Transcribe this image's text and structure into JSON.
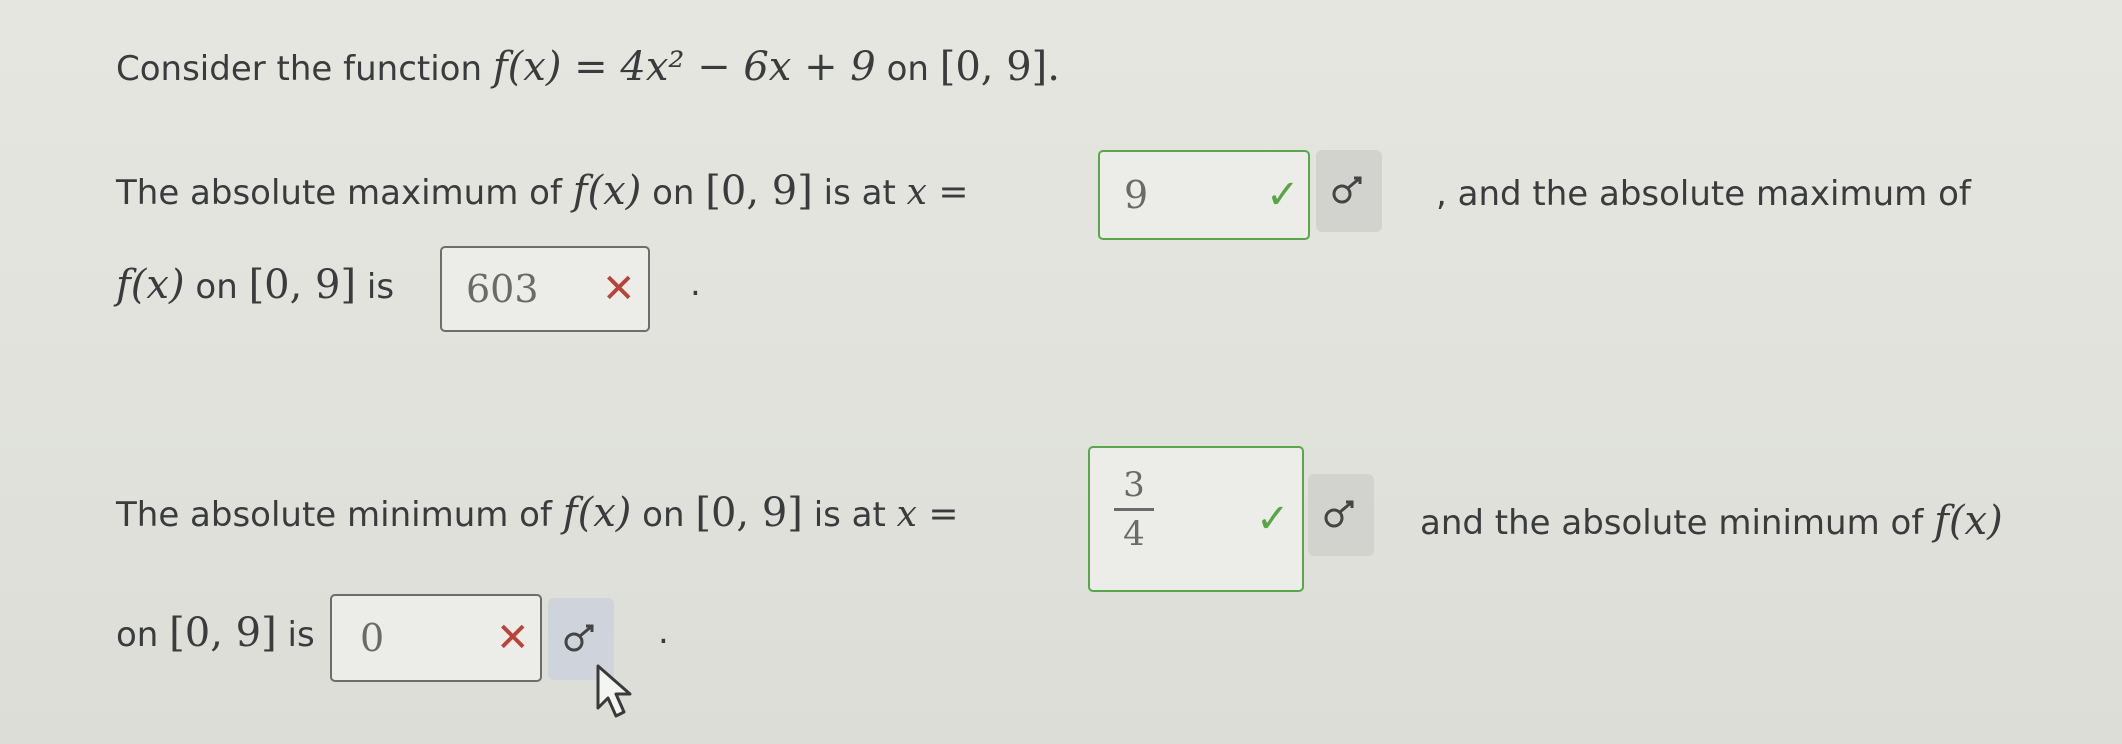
{
  "question": {
    "intro_prefix": "Consider the function",
    "function": "f(x) = 4x² − 6x + 9",
    "on": "on",
    "interval": "[0, 9].",
    "max_x": {
      "prefix": "The absolute maximum of",
      "fx": "f(x)",
      "on": "on",
      "interval": "[0, 9]",
      "is_at": "is at",
      "var": "x =",
      "answer": "9",
      "status": "correct",
      "suffix": ", and the absolute maximum of"
    },
    "max_value": {
      "fx": "f(x)",
      "on": "on",
      "interval": "[0, 9]",
      "is": "is",
      "answer": "603",
      "status": "incorrect",
      "suffix": "."
    },
    "min_x": {
      "prefix": "The absolute minimum of",
      "fx": "f(x)",
      "on": "on",
      "interval": "[0, 9]",
      "is_at": "is at",
      "var": "x =",
      "answer_numerator": "3",
      "answer_denominator": "4",
      "status": "correct",
      "suffix": "and the absolute minimum of",
      "suffix_fx": "f(x)"
    },
    "min_value": {
      "on": "on",
      "interval": "[0, 9]",
      "is": "is",
      "answer": "0",
      "status": "incorrect",
      "suffix": "."
    }
  },
  "marks": {
    "correct": "✓",
    "incorrect": "✕"
  },
  "icons": {
    "math_editor": "function-symbol-icon",
    "cursor": "arrow-cursor-icon"
  },
  "colors": {
    "correct": "#59a545",
    "incorrect": "#b8433a",
    "background": "#e3e4de"
  }
}
